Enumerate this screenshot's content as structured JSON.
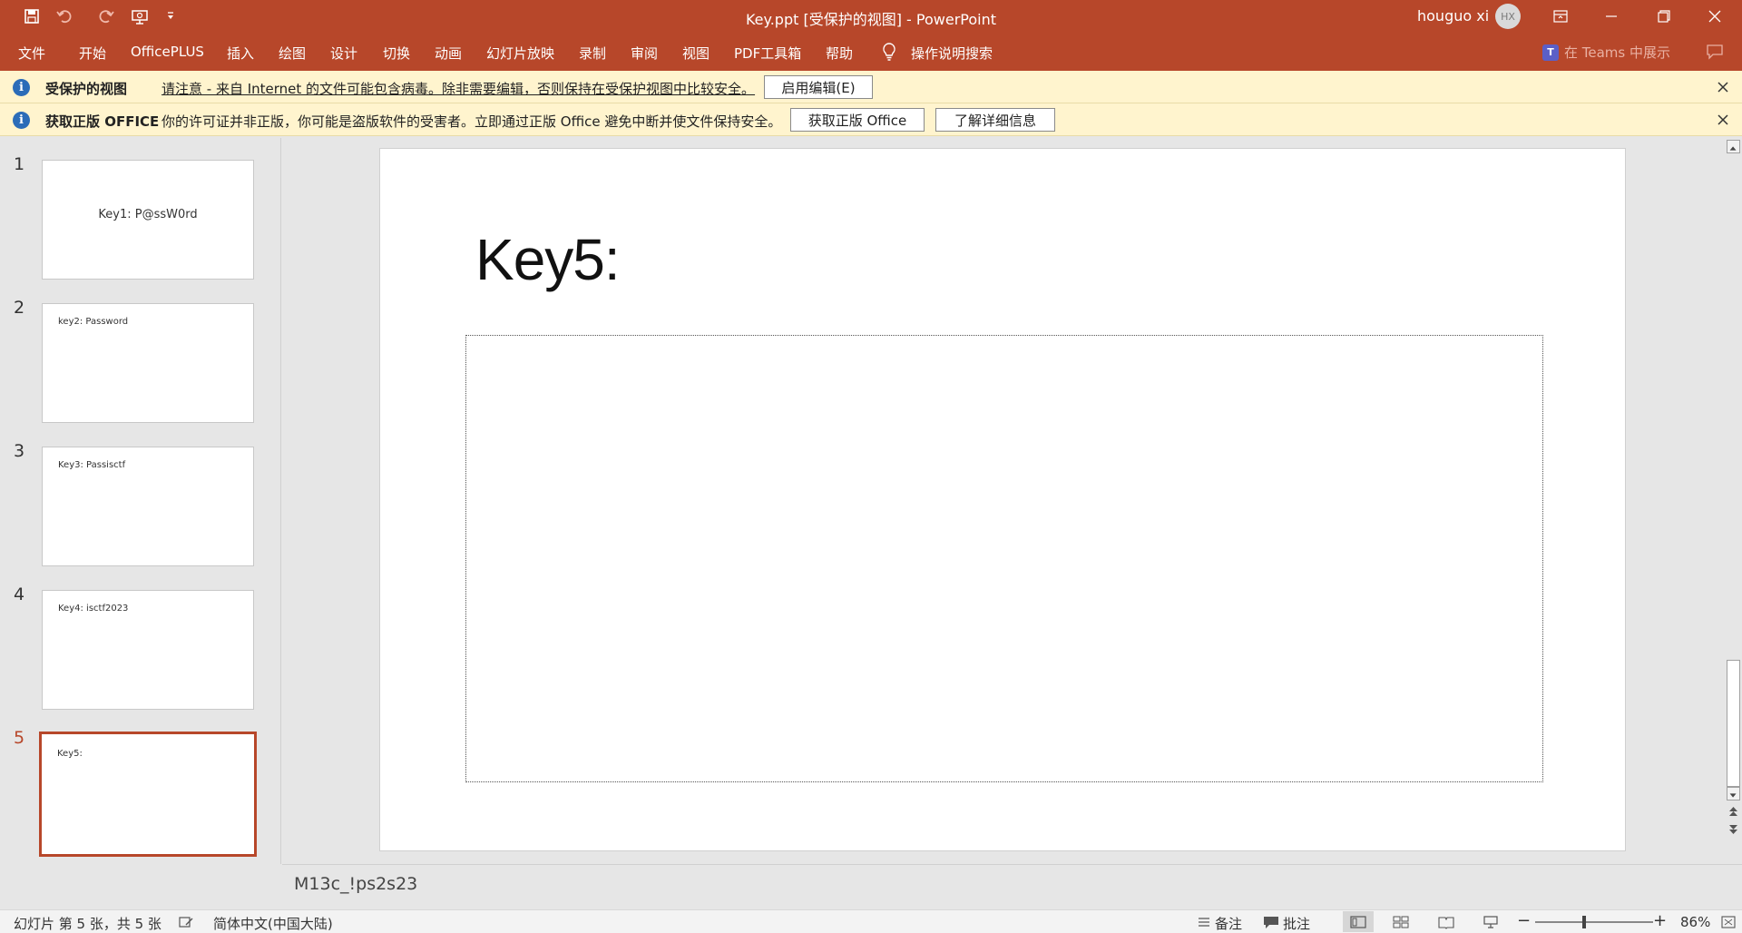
{
  "window": {
    "title": "Key.ppt [受保护的视图]  -  PowerPoint",
    "user": "houguo xi",
    "avatar_initials": "HX",
    "accent_color": "#b7472a"
  },
  "quick_access": {
    "icons": [
      "save-icon",
      "undo-icon",
      "redo-icon",
      "present-icon",
      "customize-icon"
    ]
  },
  "ribbon": {
    "tabs": [
      "文件",
      "开始",
      "OfficePLUS",
      "插入",
      "绘图",
      "设计",
      "切换",
      "动画",
      "幻灯片放映",
      "录制",
      "审阅",
      "视图",
      "PDF工具箱",
      "帮助"
    ],
    "tell_me": "操作说明搜索",
    "teams": "在 Teams 中展示"
  },
  "protected_bar": {
    "title": "受保护的视图",
    "text": "请注意 - 来自 Internet 的文件可能包含病毒。除非需要编辑，否则保持在受保护视图中比较安全。",
    "button": "启用编辑(E)"
  },
  "license_bar": {
    "title": "获取正版 OFFICE",
    "text": "你的许可证并非正版，你可能是盗版软件的受害者。立即通过正版 Office 避免中断并使文件保持安全。",
    "button_get": "获取正版 Office",
    "button_learn": "了解详细信息"
  },
  "slides": [
    {
      "number": "1",
      "text": "Key1: P@ssW0rd"
    },
    {
      "number": "2",
      "text": "key2: Password"
    },
    {
      "number": "3",
      "text": "Key3: Passisctf"
    },
    {
      "number": "4",
      "text": "Key4: isctf2023"
    },
    {
      "number": "5",
      "text": "Key5:"
    }
  ],
  "current_slide": {
    "title": "Key5:"
  },
  "notes": {
    "text": "M13c_!ps2s23"
  },
  "status": {
    "slide_info": "幻灯片 第 5 张，共 5 张",
    "language": "简体中文(中国大陆)",
    "notes_label": "备注",
    "comments_label": "批注",
    "zoom": "86%"
  }
}
